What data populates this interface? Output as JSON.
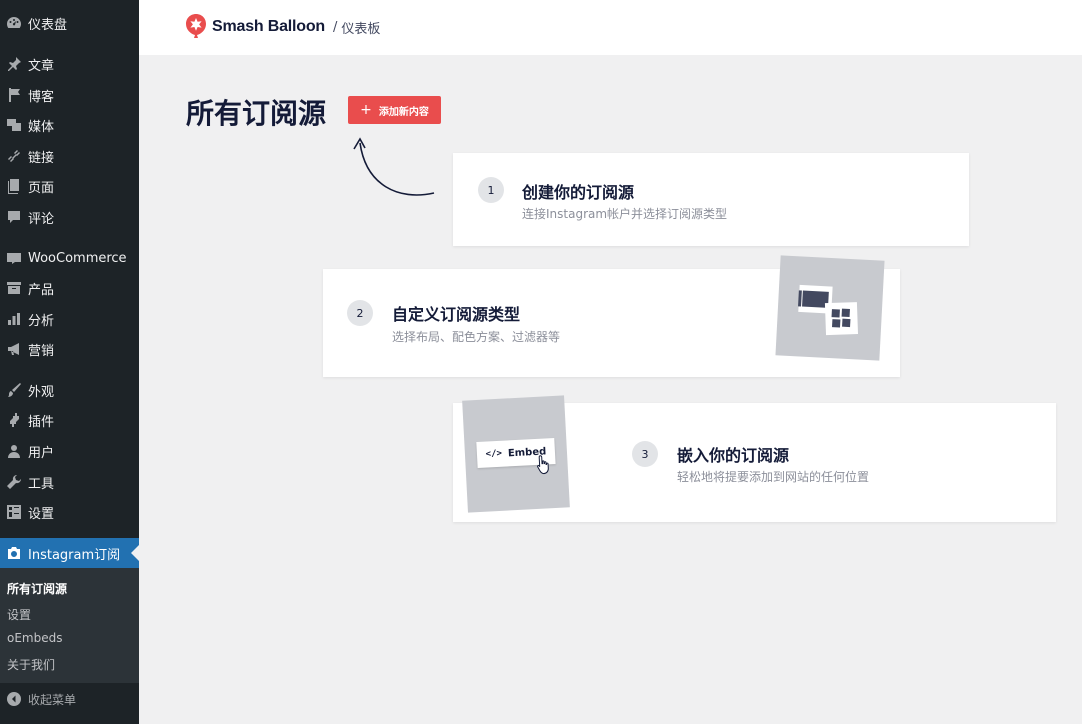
{
  "sidebar": {
    "items": [
      {
        "label": "仪表盘",
        "icon": "dashboard-icon"
      },
      {
        "label": "文章",
        "icon": "pin-icon"
      },
      {
        "label": "博客",
        "icon": "flag-icon"
      },
      {
        "label": "媒体",
        "icon": "media-icon"
      },
      {
        "label": "链接",
        "icon": "link-icon"
      },
      {
        "label": "页面",
        "icon": "page-icon"
      },
      {
        "label": "评论",
        "icon": "comment-icon"
      },
      {
        "label": "WooCommerce",
        "icon": "woo-icon"
      },
      {
        "label": "产品",
        "icon": "archive-icon"
      },
      {
        "label": "分析",
        "icon": "chart-icon"
      },
      {
        "label": "营销",
        "icon": "megaphone-icon"
      },
      {
        "label": "外观",
        "icon": "brush-icon"
      },
      {
        "label": "插件",
        "icon": "plugin-icon"
      },
      {
        "label": "用户",
        "icon": "user-icon"
      },
      {
        "label": "工具",
        "icon": "wrench-icon"
      },
      {
        "label": "设置",
        "icon": "settings-icon"
      },
      {
        "label": "Instagram订阅",
        "icon": "camera-icon"
      }
    ],
    "submenu": [
      "所有订阅源",
      "设置",
      "oEmbeds",
      "关于我们"
    ],
    "collapse_label": "收起菜单"
  },
  "header": {
    "brand": "Smash Balloon",
    "separator": "/",
    "crumb": "仪表板",
    "brand_color": "#e94d4d"
  },
  "main": {
    "title": "所有订阅源",
    "add_button": "添加新内容",
    "add_button_plus": "+",
    "steps": [
      {
        "num": "1",
        "title": "创建你的订阅源",
        "desc": "连接Instagram帐户并选择订阅源类型"
      },
      {
        "num": "2",
        "title": "自定义订阅源类型",
        "desc": "选择布局、配色方案、过滤器等"
      },
      {
        "num": "3",
        "title": "嵌入你的订阅源",
        "desc": "轻松地将提要添加到网站的任何位置"
      }
    ],
    "embed_label": "Embed",
    "embed_code": "</>"
  },
  "colors": {
    "sidebar_bg": "#1d2327",
    "active_bg": "#2271b1",
    "accent": "#e94d4d"
  }
}
